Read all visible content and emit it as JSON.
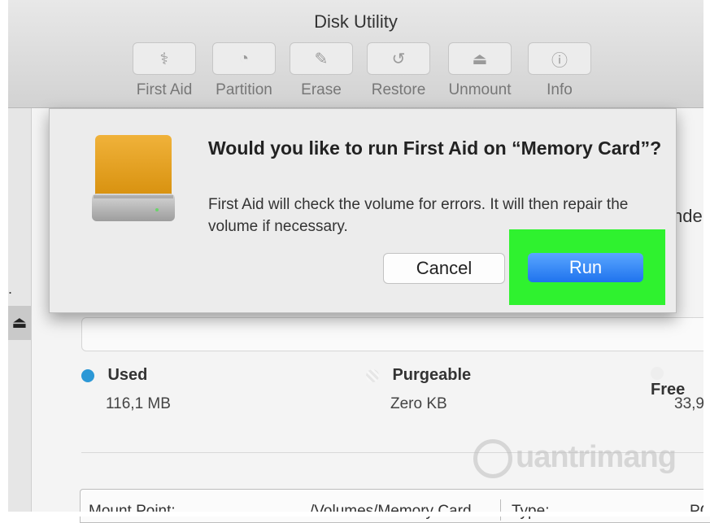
{
  "window": {
    "title": "Disk Utility"
  },
  "toolbar": {
    "buttons": [
      {
        "label": "First Aid",
        "icon": "stethoscope-icon",
        "glyph": "⚕"
      },
      {
        "label": "Partition",
        "icon": "pie-chart-icon",
        "glyph": "◔"
      },
      {
        "label": "Erase",
        "icon": "eraser-icon",
        "glyph": "✎"
      },
      {
        "label": "Restore",
        "icon": "restore-icon",
        "glyph": "↺"
      },
      {
        "label": "Unmount",
        "icon": "eject-icon",
        "glyph": "⏏"
      },
      {
        "label": "Info",
        "icon": "info-icon",
        "glyph": "ⓘ"
      }
    ]
  },
  "sidebar": {
    "eject_glyph": "⏏",
    "dot": "."
  },
  "main": {
    "partial_right_text": "nde",
    "legend": {
      "used": {
        "label": "Used",
        "value": "116,1 MB",
        "color": "#2c98d6"
      },
      "purgeable": {
        "label": "Purgeable",
        "value": "Zero KB"
      },
      "free": {
        "label": "Free",
        "value": "33,9"
      }
    },
    "info": {
      "mount_point_label": "Mount Point:",
      "mount_point_value": "/Volumes/Memory Card",
      "type_label": "Type:",
      "type_value": "PC"
    }
  },
  "dialog": {
    "title": "Would you like to run First Aid on “Memory Card”?",
    "message": "First Aid will check the volume for errors. It will then repair the volume if necessary.",
    "cancel_label": "Cancel",
    "run_label": "Run",
    "highlight_color": "#2ff22f",
    "run_color": "#2f80f0"
  },
  "watermark": {
    "text": "uantrimang"
  }
}
